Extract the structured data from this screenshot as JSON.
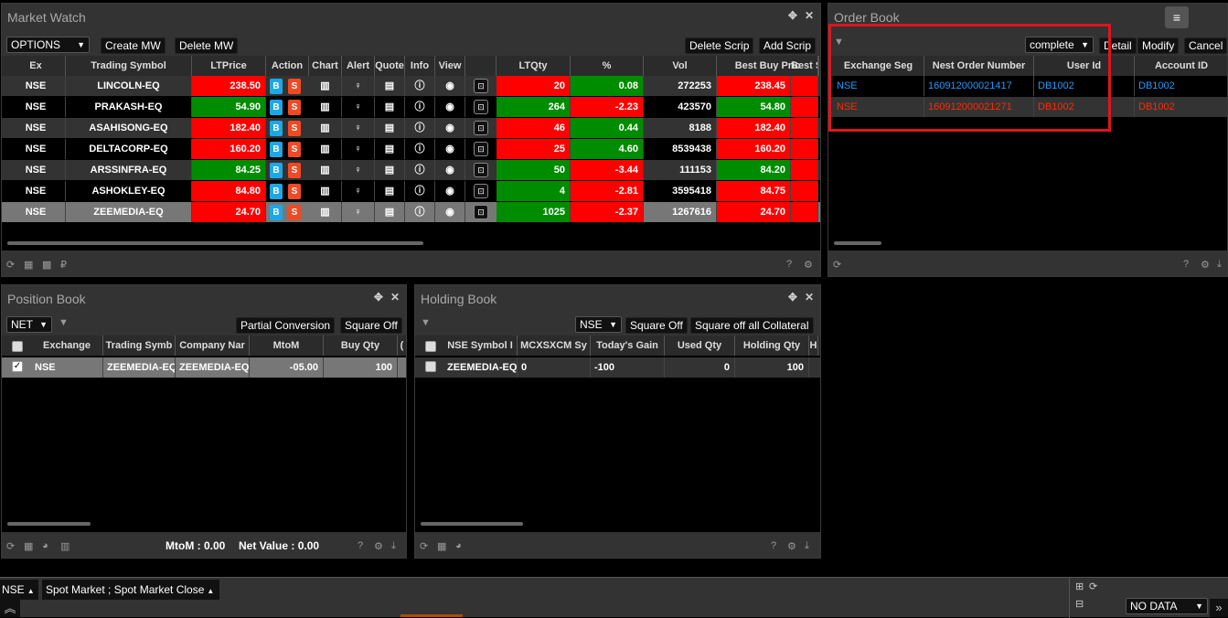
{
  "market_watch": {
    "title": "Market Watch",
    "group_select": "OPTIONS",
    "create_mw": "Create MW",
    "delete_mw": "Delete MW",
    "delete_scrip": "Delete Scrip",
    "add_scrip": "Add Scrip",
    "headers": [
      "Ex",
      "Trading Symbol",
      "LTPrice",
      "Action",
      "Chart",
      "Alert",
      "Quote",
      "Info",
      "View",
      "",
      "LTQty",
      "%",
      "Vol",
      "Best Buy Pric",
      "Best S"
    ],
    "buy_label": "B",
    "sell_label": "S",
    "rows": [
      {
        "ex": "NSE",
        "sym": "LINCOLN-EQ",
        "ltp": "238.50",
        "ltqty": "20",
        "pct": "0.08",
        "vol": "272253",
        "bbp": "238.45"
      },
      {
        "ex": "NSE",
        "sym": "PRAKASH-EQ",
        "ltp": "54.90",
        "ltqty": "264",
        "pct": "-2.23",
        "vol": "423570",
        "bbp": "54.80"
      },
      {
        "ex": "NSE",
        "sym": "ASAHISONG-EQ",
        "ltp": "182.40",
        "ltqty": "46",
        "pct": "0.44",
        "vol": "8188",
        "bbp": "182.40"
      },
      {
        "ex": "NSE",
        "sym": "DELTACORP-EQ",
        "ltp": "160.20",
        "ltqty": "25",
        "pct": "4.60",
        "vol": "8539438",
        "bbp": "160.20"
      },
      {
        "ex": "NSE",
        "sym": "ARSSINFRA-EQ",
        "ltp": "84.25",
        "ltqty": "50",
        "pct": "-3.44",
        "vol": "111153",
        "bbp": "84.20"
      },
      {
        "ex": "NSE",
        "sym": "ASHOKLEY-EQ",
        "ltp": "84.80",
        "ltqty": "4",
        "pct": "-2.81",
        "vol": "3595418",
        "bbp": "84.75"
      },
      {
        "ex": "NSE",
        "sym": "ZEEMEDIA-EQ",
        "ltp": "24.70",
        "ltqty": "1025",
        "pct": "-2.37",
        "vol": "1267616",
        "bbp": "24.70"
      }
    ]
  },
  "order_book": {
    "title": "Order Book",
    "filter_select": "complete",
    "detail": "Detail",
    "modify": "Modify",
    "cancel": "Cancel",
    "headers": [
      "Exchange Seg",
      "Nest Order Number",
      "User Id",
      "Account ID"
    ],
    "rows": [
      {
        "seg": "NSE",
        "order": "160912000021417",
        "user": "DB1002",
        "acct": "DB1002"
      },
      {
        "seg": "NSE",
        "order": "160912000021271",
        "user": "DB1002",
        "acct": "DB1002"
      }
    ]
  },
  "position_book": {
    "title": "Position Book",
    "net_select": "NET",
    "partial": "Partial Conversion",
    "square_off": "Square Off",
    "headers": [
      "Exchange",
      "Trading Symb",
      "Company Nar",
      "MtoM",
      "Buy Qty",
      "("
    ],
    "rows": [
      {
        "ex": "NSE",
        "sym": "ZEEMEDIA-EQ",
        "comp": "ZEEMEDIA-EQ",
        "mtom": "-05.00",
        "buyqty": "100"
      }
    ],
    "mtom_label": "MtoM : 0.00",
    "netval_label": "Net Value : 0.00"
  },
  "holding_book": {
    "title": "Holding Book",
    "ex_select": "NSE",
    "square_off": "Square Off",
    "square_off_all": "Square off all Collateral",
    "headers": [
      "NSE Symbol I",
      "MCXSXCM Sy",
      "Today's Gain",
      "Used Qty",
      "Holding Qty",
      "H"
    ],
    "rows": [
      {
        "nse": "ZEEMEDIA-EQ",
        "mcx": "0",
        "gain": "-100",
        "used": "0",
        "hold": "100"
      }
    ]
  },
  "status_bar": {
    "exchange": "NSE",
    "market_status": "Spot Market ; Spot Market Close",
    "no_data": "NO DATA"
  },
  "colors": {
    "up": "#008c00",
    "down": "#ff0000",
    "buy": "#1ea7e8",
    "sell": "#f04a24",
    "highlight": "#e0141e",
    "order_complete": "#1e9bff",
    "order_rejected": "#ff2a00"
  }
}
